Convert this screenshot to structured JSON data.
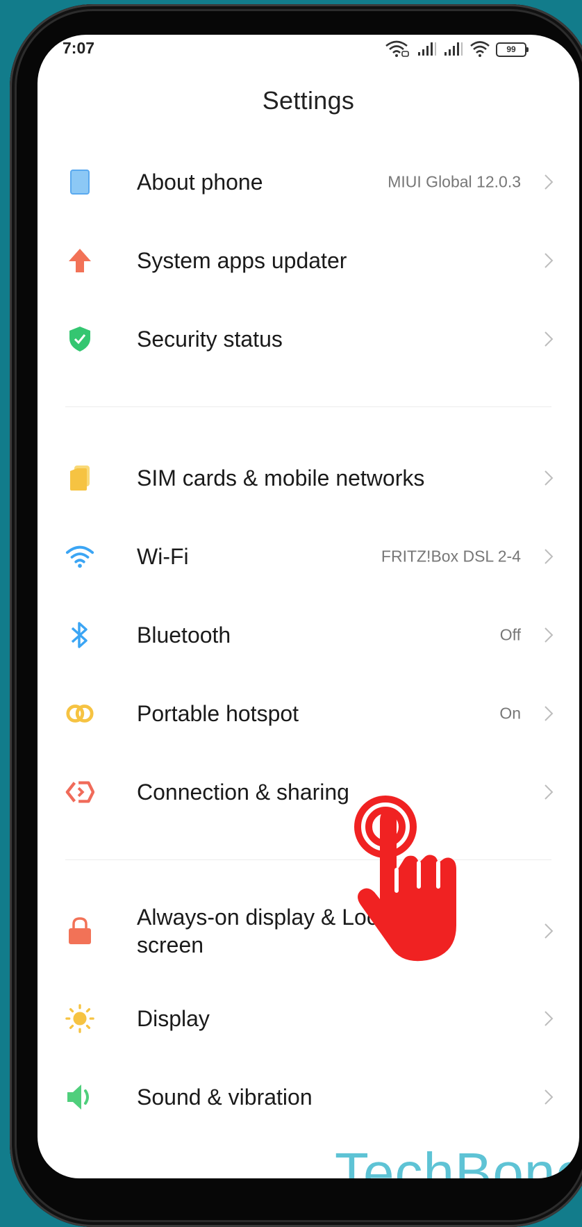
{
  "status_bar": {
    "time": "7:07",
    "battery": "99",
    "icons": [
      "wifi-calling-icon",
      "signal-icon",
      "signal-icon",
      "wifi-icon",
      "battery-icon"
    ]
  },
  "header": {
    "title": "Settings"
  },
  "groups": [
    {
      "items": [
        {
          "label": "About phone",
          "value": "MIUI Global 12.0.3",
          "icon": "phone-icon",
          "color": "#5aa9ef"
        },
        {
          "label": "System apps updater",
          "value": "",
          "icon": "arrow-up-icon",
          "color": "#f27257"
        },
        {
          "label": "Security status",
          "value": "",
          "icon": "shield-check-icon",
          "color": "#34c671"
        }
      ]
    },
    {
      "items": [
        {
          "label": "SIM cards & mobile networks",
          "value": "",
          "icon": "sim-card-icon",
          "color": "#f6c342"
        },
        {
          "label": "Wi-Fi",
          "value": "FRITZ!Box DSL 2-4",
          "icon": "wifi-icon",
          "color": "#3ba5f4"
        },
        {
          "label": "Bluetooth",
          "value": "Off",
          "icon": "bluetooth-icon",
          "color": "#3ba5f4"
        },
        {
          "label": "Portable hotspot",
          "value": "On",
          "icon": "hotspot-icon",
          "color": "#f6c342"
        },
        {
          "label": "Connection & sharing",
          "value": "",
          "icon": "connection-sharing-icon",
          "color": "#f06b5a"
        }
      ]
    },
    {
      "items": [
        {
          "label_line1": "Always-on display & Lock",
          "label_line2": "screen",
          "value": "",
          "icon": "lock-icon",
          "color": "#f27257"
        },
        {
          "label": "Display",
          "value": "",
          "icon": "sun-icon",
          "color": "#f6c342"
        },
        {
          "label": "Sound & vibration",
          "value": "",
          "icon": "speaker-icon",
          "color": "#4fcf7c"
        }
      ]
    }
  ],
  "overlay": {
    "tap_icon": "tap-hand-icon",
    "tap_color": "#f02222"
  },
  "watermark": {
    "text": "TechBone"
  }
}
